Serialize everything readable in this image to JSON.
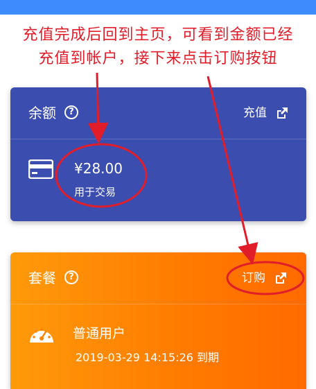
{
  "annotation": {
    "line1": "充值完成后回到主页，可看到金额已经",
    "line2": "充值到帐户，接下来点击订购按钮"
  },
  "balance_card": {
    "title": "余额",
    "help": "?",
    "action_label": "充值",
    "amount": "¥28.00",
    "subtitle": "用于交易",
    "icon": "credit-card-icon"
  },
  "plan_card": {
    "title": "套餐",
    "help": "?",
    "action_label": "订购",
    "plan_name": "普通用户",
    "expiry": "2019-03-29 14:15:26 到期",
    "icon": "speedometer-icon"
  },
  "colors": {
    "annotation_red": "#e11d2a",
    "balance_bg": "#3c4db0",
    "plan_bg": "#ff7a00",
    "topbar": "#3d8bfd"
  }
}
